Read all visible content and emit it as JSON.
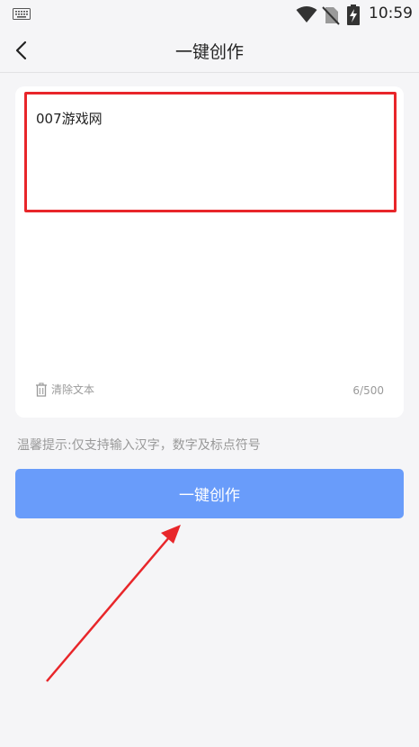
{
  "status_bar": {
    "time": "10:59",
    "icons": [
      "keyboard-icon",
      "wifi-icon",
      "no-sim-icon",
      "battery-charging-icon"
    ]
  },
  "header": {
    "title": "一键创作",
    "back_icon": "chevron-left-icon"
  },
  "editor": {
    "text": "007游戏网",
    "clear_label": "清除文本",
    "clear_icon": "trash-icon",
    "counter": "6/500"
  },
  "tip": "温馨提示:仅支持输入汉字，数字及标点符号",
  "create_button_label": "一键创作",
  "colors": {
    "accent": "#699cfa",
    "highlight": "#e8262a",
    "background": "#f5f5f7"
  }
}
